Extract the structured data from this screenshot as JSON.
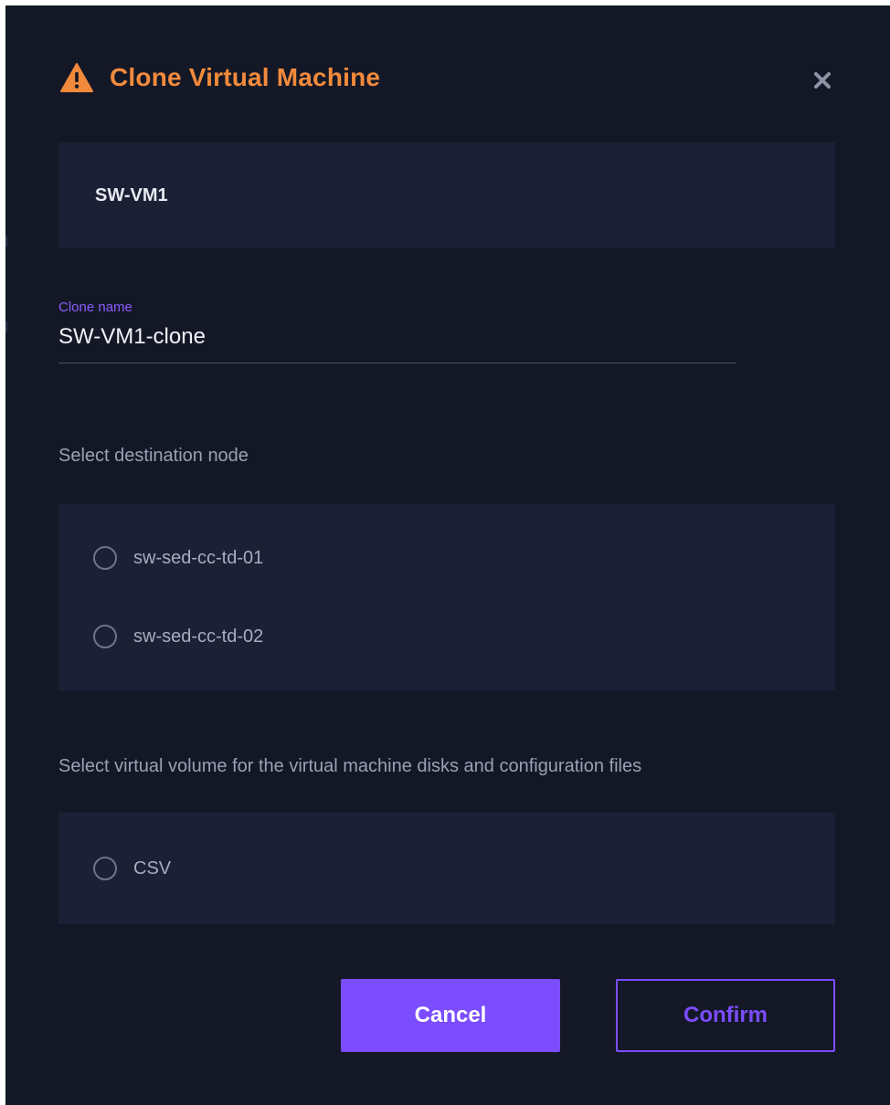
{
  "dialog": {
    "title": "Clone Virtual Machine",
    "title_color": "#f28a3c",
    "warning_icon": "warning-triangle-icon",
    "close_icon": "close-icon"
  },
  "source_vm": {
    "name": "SW-VM1"
  },
  "clone_name": {
    "label": "Clone name",
    "value": "SW-VM1-clone"
  },
  "destination_node": {
    "label": "Select destination node",
    "options": [
      {
        "label": "sw-sed-cc-td-01",
        "selected": false
      },
      {
        "label": "sw-sed-cc-td-02",
        "selected": false
      }
    ]
  },
  "virtual_volume": {
    "label": "Select virtual volume for the virtual machine disks and configuration files",
    "options": [
      {
        "label": "CSV",
        "selected": false
      }
    ]
  },
  "actions": {
    "cancel_label": "Cancel",
    "confirm_label": "Confirm",
    "accent_color": "#7b4dff"
  }
}
